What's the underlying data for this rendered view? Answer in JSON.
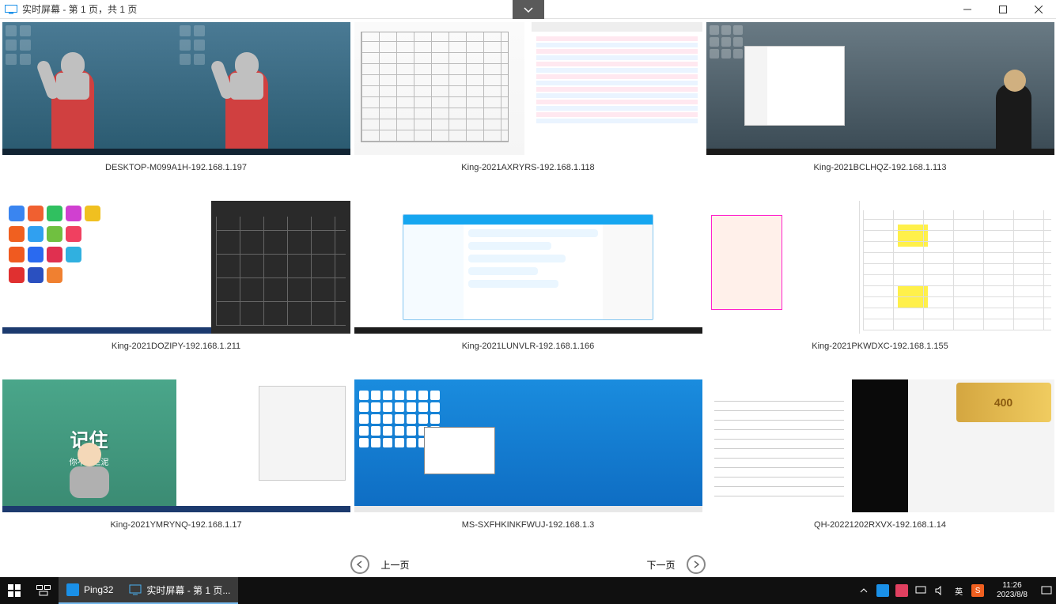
{
  "titlebar": {
    "title": "实时屏幕 - 第 1 页，共 1 页"
  },
  "screens": [
    {
      "label": "DESKTOP-M099A1H-192.168.1.197",
      "style": "ultraman"
    },
    {
      "label": "King-2021AXRYRS-192.168.1.118",
      "style": "cad-table"
    },
    {
      "label": "King-2021BCLHQZ-192.168.1.113",
      "style": "darkdesk"
    },
    {
      "label": "King-2021DOZIPY-192.168.1.211",
      "style": "splitbr"
    },
    {
      "label": "King-2021LUNVLR-192.168.1.166",
      "style": "chat"
    },
    {
      "label": "King-2021PKWDXC-192.168.1.155",
      "style": "office"
    },
    {
      "label": "King-2021YMRYNQ-192.168.1.17",
      "style": "monk"
    },
    {
      "label": "MS-SXFHKINKFWUJ-192.168.1.3",
      "style": "bluewin"
    },
    {
      "label": "QH-20221202RXVX-192.168.1.14",
      "style": "docsplit"
    }
  ],
  "monk_scene": {
    "big": "记住",
    "small": "你不是烂泥"
  },
  "docsplit_banner": "400",
  "pager": {
    "prev": "上一页",
    "next": "下一页"
  },
  "taskbar": {
    "app1": "Ping32",
    "app2": "实时屏幕 - 第 1 页...",
    "ime": "英",
    "time": "11:26",
    "date": "2023/8/8"
  }
}
